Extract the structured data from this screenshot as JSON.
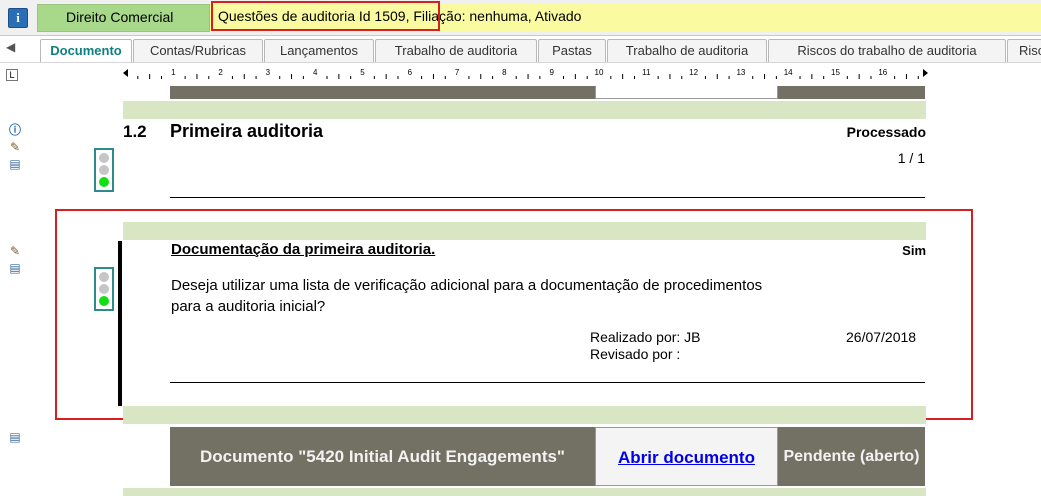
{
  "topbar": {
    "info_icon": "info-icon",
    "area": "Direito Comercial",
    "title": "Questões de auditoria Id 1509, Filiação: nenhuma, Ativado"
  },
  "tabs": [
    "Documento",
    "Contas/Rubricas",
    "Lançamentos",
    "Trabalho de auditoria",
    "Pastas",
    "Trabalho de auditoria",
    "Riscos do trabalho de auditoria",
    "Risco"
  ],
  "ruler": {
    "corner": "L",
    "numbers": [
      "1",
      "2",
      "3",
      "4",
      "5",
      "6",
      "7",
      "8",
      "9",
      "10",
      "11",
      "12",
      "13",
      "14",
      "15",
      "16"
    ]
  },
  "section": {
    "number": "1.2",
    "title": "Primeira auditoria",
    "status": "Processado",
    "pages": "1 / 1"
  },
  "question": {
    "title": "Documentação da primeira auditoria.",
    "answer": "Sim",
    "text": "Deseja utilizar uma lista de verificação adicional para a documentação de procedimentos para a auditoria inicial?",
    "done_by_label": "Realizado por: JB",
    "reviewed_by_label": "Revisado por :",
    "date": "26/07/2018"
  },
  "document_row": {
    "name": "Documento \"5420 Initial Audit Engagements\"",
    "link": "Abrir documento",
    "status": "Pendente (aberto)"
  },
  "colors": {
    "accent_tab": "#0f7f7f",
    "highlight": "#d62020",
    "green_band": "#d8e6c4",
    "gray_block": "#737163",
    "title_bar": "#fafaa0",
    "area_bar": "#a8d88a"
  }
}
